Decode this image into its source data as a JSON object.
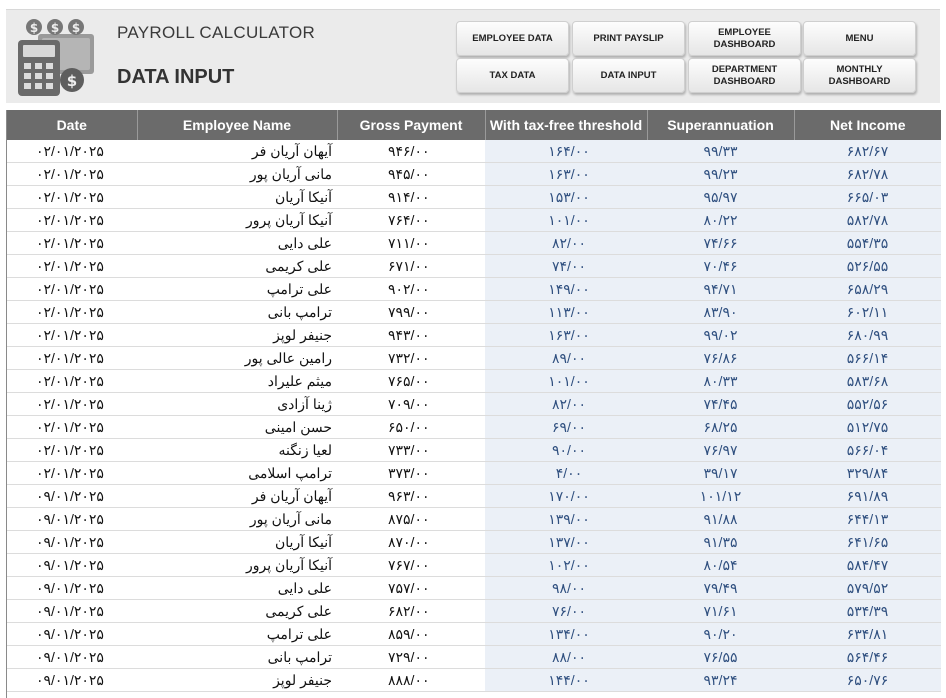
{
  "header": {
    "app_title": "PAYROLL CALCULATOR",
    "page_title": "DATA INPUT"
  },
  "buttons": {
    "employee_data": "EMPLOYEE DATA",
    "print_payslip": "PRINT PAYSLIP",
    "employee_dashboard": "EMPLOYEE DASHBOARD",
    "menu": "MENU",
    "tax_data": "TAX DATA",
    "data_input": "DATA INPUT",
    "department_dashboard": "DEPARTMENT DASHBOARD",
    "monthly_dashboard": "MONTHLY DASHBOARD"
  },
  "table": {
    "columns": [
      "Date",
      "Employee Name",
      "Gross Payment",
      "With tax-free threshold",
      "Superannuation",
      "Net Income"
    ],
    "rows": [
      [
        "۰۲/۰۱/۲۰۲۵",
        "آیهان آریان فر",
        "۹۴۶/۰۰",
        "۱۶۴/۰۰",
        "۹۹/۳۳",
        "۶۸۲/۶۷"
      ],
      [
        "۰۲/۰۱/۲۰۲۵",
        "مانی آریان پور",
        "۹۴۵/۰۰",
        "۱۶۳/۰۰",
        "۹۹/۲۳",
        "۶۸۲/۷۸"
      ],
      [
        "۰۲/۰۱/۲۰۲۵",
        "آنیکا آریان",
        "۹۱۴/۰۰",
        "۱۵۳/۰۰",
        "۹۵/۹۷",
        "۶۶۵/۰۳"
      ],
      [
        "۰۲/۰۱/۲۰۲۵",
        "آنیکا آریان پرور",
        "۷۶۴/۰۰",
        "۱۰۱/۰۰",
        "۸۰/۲۲",
        "۵۸۲/۷۸"
      ],
      [
        "۰۲/۰۱/۲۰۲۵",
        "علی دایی",
        "۷۱۱/۰۰",
        "۸۲/۰۰",
        "۷۴/۶۶",
        "۵۵۴/۳۵"
      ],
      [
        "۰۲/۰۱/۲۰۲۵",
        "علی کریمی",
        "۶۷۱/۰۰",
        "۷۴/۰۰",
        "۷۰/۴۶",
        "۵۲۶/۵۵"
      ],
      [
        "۰۲/۰۱/۲۰۲۵",
        "علی ترامپ",
        "۹۰۲/۰۰",
        "۱۴۹/۰۰",
        "۹۴/۷۱",
        "۶۵۸/۲۹"
      ],
      [
        "۰۲/۰۱/۲۰۲۵",
        "ترامپ بانی",
        "۷۹۹/۰۰",
        "۱۱۳/۰۰",
        "۸۳/۹۰",
        "۶۰۲/۱۱"
      ],
      [
        "۰۲/۰۱/۲۰۲۵",
        "جنیفر لوپز",
        "۹۴۳/۰۰",
        "۱۶۳/۰۰",
        "۹۹/۰۲",
        "۶۸۰/۹۹"
      ],
      [
        "۰۲/۰۱/۲۰۲۵",
        "رامین عالی پور",
        "۷۳۲/۰۰",
        "۸۹/۰۰",
        "۷۶/۸۶",
        "۵۶۶/۱۴"
      ],
      [
        "۰۲/۰۱/۲۰۲۵",
        "میثم علیراد",
        "۷۶۵/۰۰",
        "۱۰۱/۰۰",
        "۸۰/۳۳",
        "۵۸۳/۶۸"
      ],
      [
        "۰۲/۰۱/۲۰۲۵",
        "ژینا آزادی",
        "۷۰۹/۰۰",
        "۸۲/۰۰",
        "۷۴/۴۵",
        "۵۵۲/۵۶"
      ],
      [
        "۰۲/۰۱/۲۰۲۵",
        "حسن امینی",
        "۶۵۰/۰۰",
        "۶۹/۰۰",
        "۶۸/۲۵",
        "۵۱۲/۷۵"
      ],
      [
        "۰۲/۰۱/۲۰۲۵",
        "لعیا زنگنه",
        "۷۳۳/۰۰",
        "۹۰/۰۰",
        "۷۶/۹۷",
        "۵۶۶/۰۴"
      ],
      [
        "۰۲/۰۱/۲۰۲۵",
        "ترامپ اسلامی",
        "۳۷۳/۰۰",
        "۴/۰۰",
        "۳۹/۱۷",
        "۳۲۹/۸۴"
      ],
      [
        "۰۹/۰۱/۲۰۲۵",
        "آیهان آریان فر",
        "۹۶۳/۰۰",
        "۱۷۰/۰۰",
        "۱۰۱/۱۲",
        "۶۹۱/۸۹"
      ],
      [
        "۰۹/۰۱/۲۰۲۵",
        "مانی آریان پور",
        "۸۷۵/۰۰",
        "۱۳۹/۰۰",
        "۹۱/۸۸",
        "۶۴۴/۱۳"
      ],
      [
        "۰۹/۰۱/۲۰۲۵",
        "آنیکا آریان",
        "۸۷۰/۰۰",
        "۱۳۷/۰۰",
        "۹۱/۳۵",
        "۶۴۱/۶۵"
      ],
      [
        "۰۹/۰۱/۲۰۲۵",
        "آنیکا آریان پرور",
        "۷۶۷/۰۰",
        "۱۰۲/۰۰",
        "۸۰/۵۴",
        "۵۸۴/۴۷"
      ],
      [
        "۰۹/۰۱/۲۰۲۵",
        "علی دایی",
        "۷۵۷/۰۰",
        "۹۸/۰۰",
        "۷۹/۴۹",
        "۵۷۹/۵۲"
      ],
      [
        "۰۹/۰۱/۲۰۲۵",
        "علی کریمی",
        "۶۸۲/۰۰",
        "۷۶/۰۰",
        "۷۱/۶۱",
        "۵۳۴/۳۹"
      ],
      [
        "۰۹/۰۱/۲۰۲۵",
        "علی ترامپ",
        "۸۵۹/۰۰",
        "۱۳۴/۰۰",
        "۹۰/۲۰",
        "۶۳۴/۸۱"
      ],
      [
        "۰۹/۰۱/۲۰۲۵",
        "ترامپ بانی",
        "۷۲۹/۰۰",
        "۸۸/۰۰",
        "۷۶/۵۵",
        "۵۶۴/۴۶"
      ],
      [
        "۰۹/۰۱/۲۰۲۵",
        "جنیفر لوپز",
        "۸۸۸/۰۰",
        "۱۴۴/۰۰",
        "۹۳/۲۴",
        "۶۵۰/۷۶"
      ]
    ]
  }
}
